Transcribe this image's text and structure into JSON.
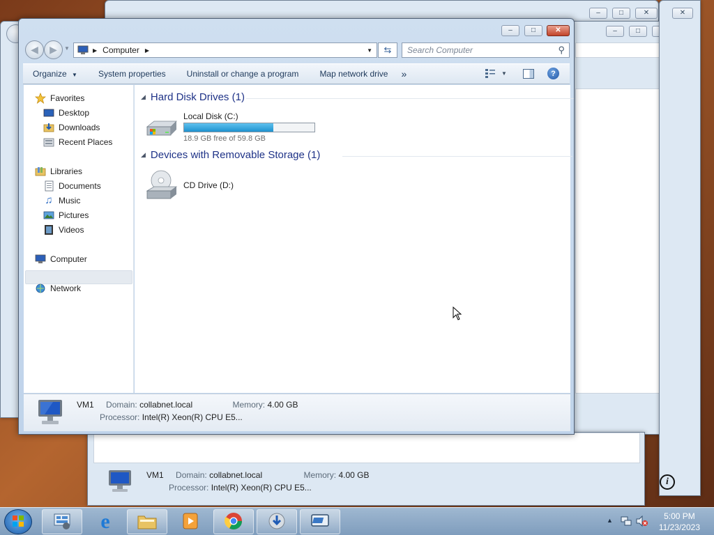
{
  "window": {
    "breadcrumb": "Computer",
    "search_placeholder": "Search Computer"
  },
  "toolbar": {
    "organize": "Organize",
    "system_properties": "System properties",
    "uninstall": "Uninstall or change a program",
    "map_drive": "Map network drive",
    "more": "»"
  },
  "nav": {
    "favorites": "Favorites",
    "desktop": "Desktop",
    "downloads": "Downloads",
    "recent": "Recent Places",
    "libraries": "Libraries",
    "documents": "Documents",
    "music": "Music",
    "pictures": "Pictures",
    "videos": "Videos",
    "computer": "Computer",
    "network": "Network"
  },
  "content": {
    "hdd_group": "Hard Disk Drives (1)",
    "removable_group": "Devices with Removable Storage (1)",
    "local_disk": {
      "name": "Local Disk (C:)",
      "free": "18.9 GB free of 59.8 GB",
      "used_fraction": 0.684
    },
    "cd_drive": "CD Drive (D:)"
  },
  "details": {
    "name": "VM1",
    "domain_label": "Domain:",
    "domain": "collabnet.local",
    "memory_label": "Memory:",
    "memory": "4.00 GB",
    "processor_label": "Processor:",
    "processor": "Intel(R) Xeon(R) CPU E5..."
  },
  "bg_window": {
    "name": "VM1",
    "domain_label": "Domain:",
    "domain": "collabnet.local",
    "memory_label": "Memory:",
    "memory": "4.00 GB",
    "processor_label": "Processor:",
    "processor": "Intel(R) Xeon(R) CPU E5..."
  },
  "taskbar": {
    "time": "5:00 PM",
    "date": "11/23/2023"
  },
  "colors": {
    "progress": "#26a0da",
    "group_header": "#1e3287",
    "selected_nav": "#e5eaf0"
  }
}
